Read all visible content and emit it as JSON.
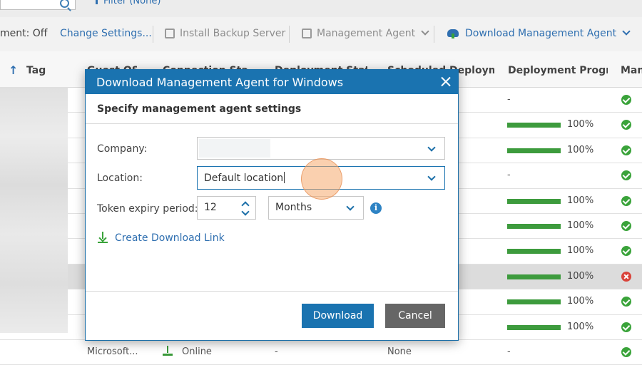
{
  "topbar": {
    "filter_label": "Filter (None)"
  },
  "toolbar": {
    "status_text": "ment: Off",
    "change_settings": "Change Settings...",
    "install_backup_server": "Install Backup Server",
    "management_agent": "Management Agent",
    "download_management_agent": "Download Management Agent"
  },
  "table": {
    "columns": [
      "Tag",
      "Guest OS",
      "Connection Status",
      "Deployment Status",
      "Scheduled Deploym...",
      "Deployment Progr...",
      "Man"
    ],
    "rows": [
      {
        "progress": "-",
        "progress_value": null,
        "status": "ok"
      },
      {
        "progress": "100%",
        "progress_value": 100,
        "status": "ok"
      },
      {
        "progress": "100%",
        "progress_value": 100,
        "status": "ok"
      },
      {
        "progress": "-",
        "progress_value": null,
        "status": "ok"
      },
      {
        "progress": "100%",
        "progress_value": 100,
        "status": "ok"
      },
      {
        "progress": "100%",
        "progress_value": 100,
        "status": "ok"
      },
      {
        "progress": "100%",
        "progress_value": 100,
        "status": "ok"
      },
      {
        "progress": "100%",
        "progress_value": 100,
        "status": "error",
        "selected": true
      },
      {
        "progress": "100%",
        "progress_value": 100,
        "status": "ok"
      },
      {
        "progress": "100%",
        "progress_value": 100,
        "status": "ok"
      }
    ],
    "last_row": {
      "guest_os": "Microsoft...",
      "connection": "Online",
      "deployment": "-",
      "scheduled": "None",
      "progress": "-"
    }
  },
  "dialog": {
    "title": "Download Management Agent for Windows",
    "subtitle": "Specify management agent settings",
    "company_label": "Company:",
    "company_value": "",
    "location_label": "Location:",
    "location_value": "Default location",
    "token_label": "Token expiry period:",
    "token_value": "12",
    "token_unit": "Months",
    "create_link": "Create Download Link",
    "download_button": "Download",
    "cancel_button": "Cancel"
  },
  "colors": {
    "accent": "#1a73b0",
    "success": "#3aa33a",
    "error": "#d9433a"
  }
}
